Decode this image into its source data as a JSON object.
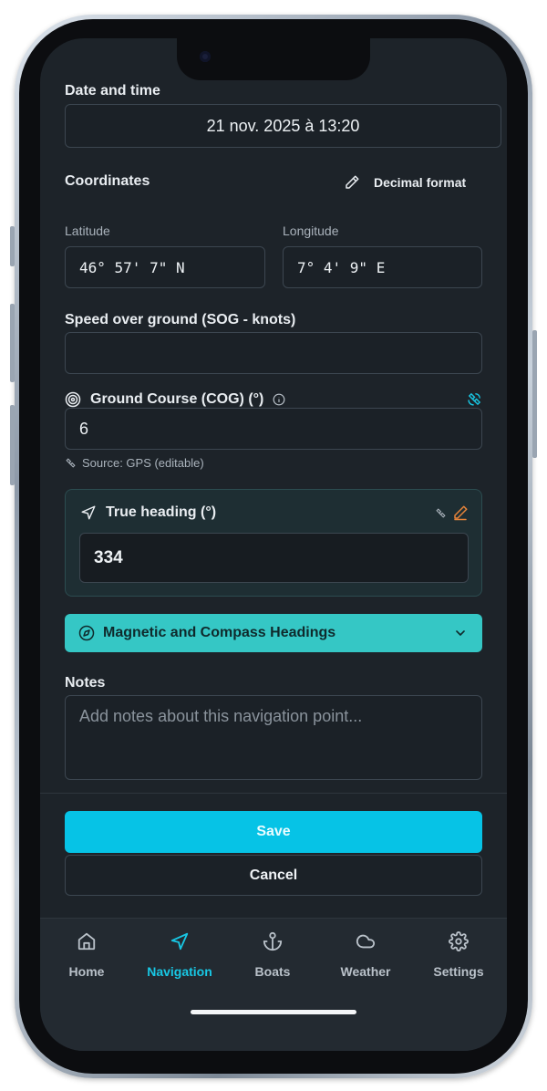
{
  "form": {
    "date_label": "Date and time",
    "date_value": "21 nov. 2025 à 13:20",
    "coordinates_label": "Coordinates",
    "decimal_format_label": "Decimal format",
    "latitude_label": "Latitude",
    "latitude_value": "46° 57' 7\" N",
    "longitude_label": "Longitude",
    "longitude_value": "7° 4' 9\" E",
    "sog_label": "Speed over ground (SOG - knots)",
    "sog_value": "",
    "cog_label": "Ground Course (COG) (°)",
    "cog_value": "6",
    "cog_source": "Source: GPS (editable)",
    "true_heading_label": "True heading (°)",
    "true_heading_value": "334",
    "magnetic_label": "Magnetic and Compass Headings",
    "notes_label": "Notes",
    "notes_placeholder": "Add notes about this navigation point...",
    "notes_value": ""
  },
  "actions": {
    "save_label": "Save",
    "cancel_label": "Cancel"
  },
  "tabbar": {
    "items": [
      {
        "label": "Home",
        "icon": "home-icon",
        "active": false
      },
      {
        "label": "Navigation",
        "icon": "navigation-arrow-icon",
        "active": true
      },
      {
        "label": "Boats",
        "icon": "anchor-icon",
        "active": false
      },
      {
        "label": "Weather",
        "icon": "cloud-icon",
        "active": false
      },
      {
        "label": "Settings",
        "icon": "gear-icon",
        "active": false
      }
    ]
  },
  "colors": {
    "background": "#1d2329",
    "accent": "#06c3e6",
    "accordion": "#35c7c5",
    "active_tab": "#18c7e4",
    "edit_pencil": "#e8843a"
  }
}
